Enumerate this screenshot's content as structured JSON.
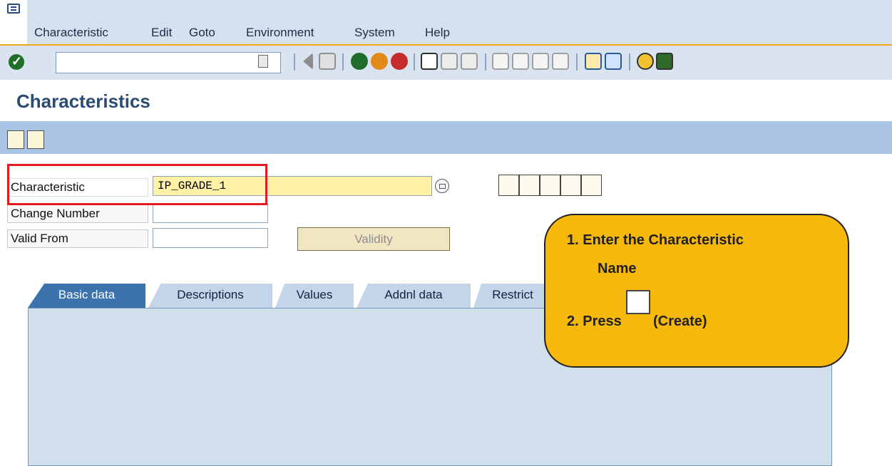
{
  "menu": {
    "items": [
      "Characteristic",
      "Edit",
      "Goto",
      "Environment",
      "System",
      "Help"
    ]
  },
  "toolbar": {
    "command_field_value": "",
    "buttons": [
      "enter-icon",
      "save-icon",
      "back-icon",
      "exit-icon",
      "cancel-icon",
      "print-icon",
      "find-icon",
      "find-next-icon",
      "first-page-icon",
      "previous-page-icon",
      "next-page-icon",
      "last-page-icon",
      "create-session-icon",
      "shortcut-icon",
      "help-icon",
      "layout-icon"
    ]
  },
  "page": {
    "title": "Characteristics"
  },
  "form": {
    "characteristic": {
      "label": "Characteristic",
      "value": "IP_GRADE_1"
    },
    "change_number": {
      "label": "Change Number",
      "value": ""
    },
    "valid_from": {
      "label": "Valid From",
      "value": ""
    },
    "validity_button": "Validity"
  },
  "tabs": [
    "Basic data",
    "Descriptions",
    "Values",
    "Addnl data",
    "Restrict"
  ],
  "callout": {
    "step1": "1. Enter the Characteristic",
    "step1b": "Name",
    "step2": "2. Press",
    "step2_icon": "create-icon",
    "step2_suffix": "(Create)"
  },
  "colors": {
    "menu_bg": "#d6e1ef",
    "toolbar_bg": "#dae4f1",
    "app_toolbar_bg": "#a9c4e4",
    "title": "#2b4c72",
    "tab_active": "#3d73ad",
    "tab_inactive": "#c4d5e9",
    "callout_bg": "#f7b80c",
    "highlight": "#e31b23"
  }
}
